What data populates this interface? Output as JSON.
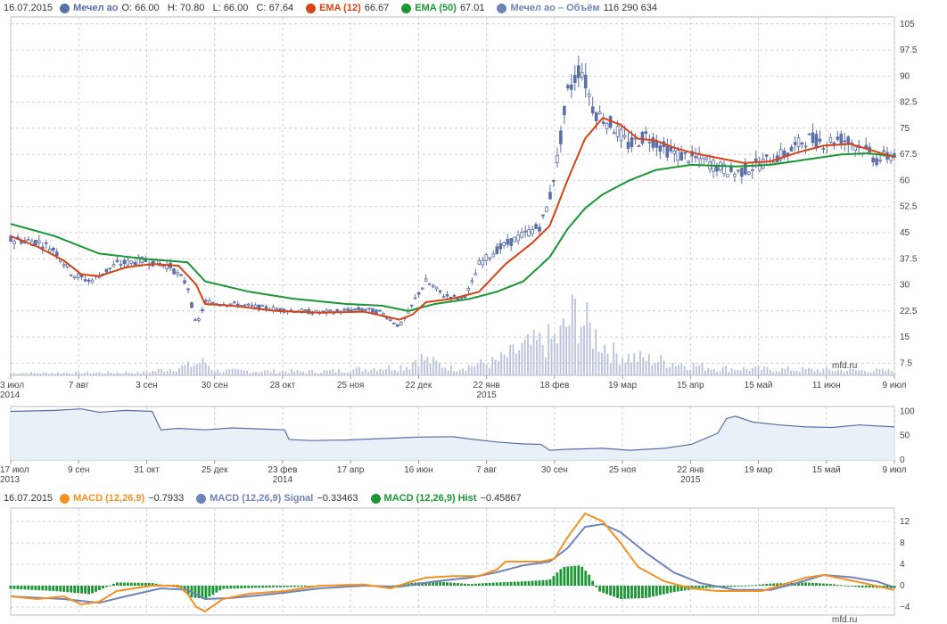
{
  "main_legend": {
    "date": "16.07.2015",
    "ticker": "Мечел ао",
    "ohlc": "O: 66.00   H: 70.80   L: 66.00   C: 67.64",
    "ema12_label": "EMA (12)",
    "ema12_value": "66.67",
    "ema50_label": "EMA (50)",
    "ema50_value": "67.01",
    "volume_label": "Мечел ао – Объём",
    "volume_value": "116 290 634"
  },
  "macd_legend": {
    "date": "16.07.2015",
    "macd_label": "MACD (12,26,9)",
    "macd_value": "−0.7933",
    "signal_label": "MACD (12,26,9) Signal",
    "signal_value": "−0.33463",
    "hist_label": "MACD (12,26,9) Hist",
    "hist_value": "−0.45867"
  },
  "watermark": "mfd.ru",
  "colors": {
    "price": "#5b6fa8",
    "ema12": "#d84315",
    "ema50": "#1a9632",
    "volume": "#b8c1dc",
    "macd": "#f39223",
    "signal": "#6f83b9",
    "hist": "#1a9632",
    "nav_fill": "#e8f0f8",
    "grid": "#cfcfcf"
  },
  "chart_data": [
    {
      "type": "line",
      "name": "price",
      "x_ticks": [
        "3 июл\n2014",
        "7 авг",
        "3 сен",
        "30 сен",
        "28 окт",
        "25 ноя",
        "22 дек",
        "22 янв\n2015",
        "18 фев",
        "19 мар",
        "15 апр",
        "15 май",
        "11 июн",
        "9 июл"
      ],
      "y_ticks": [
        "7.5",
        "15",
        "22.5",
        "30",
        "37.5",
        "45",
        "52.5",
        "60",
        "67.5",
        "75",
        "82.5",
        "90",
        "97.5",
        "105"
      ],
      "ylim": [
        4,
        107
      ],
      "series": [
        {
          "name": "Мечел ао",
          "points": [
            [
              0,
              43
            ],
            [
              0.03,
              42.5
            ],
            [
              0.05,
              40
            ],
            [
              0.07,
              33
            ],
            [
              0.09,
              31
            ],
            [
              0.12,
              36
            ],
            [
              0.15,
              37
            ],
            [
              0.18,
              35.5
            ],
            [
              0.2,
              30
            ],
            [
              0.21,
              18
            ],
            [
              0.22,
              25
            ],
            [
              0.25,
              24.5
            ],
            [
              0.3,
              23
            ],
            [
              0.35,
              22
            ],
            [
              0.4,
              23
            ],
            [
              0.42,
              22
            ],
            [
              0.43,
              20
            ],
            [
              0.44,
              18
            ],
            [
              0.45,
              22
            ],
            [
              0.46,
              27
            ],
            [
              0.47,
              31
            ],
            [
              0.49,
              27
            ],
            [
              0.51,
              26
            ],
            [
              0.52,
              29
            ],
            [
              0.53,
              36
            ],
            [
              0.55,
              40
            ],
            [
              0.57,
              43
            ],
            [
              0.6,
              47
            ],
            [
              0.61,
              55
            ],
            [
              0.62,
              68
            ],
            [
              0.63,
              85
            ],
            [
              0.645,
              93
            ],
            [
              0.66,
              80
            ],
            [
              0.68,
              76
            ],
            [
              0.7,
              70
            ],
            [
              0.72,
              73
            ],
            [
              0.74,
              69
            ],
            [
              0.76,
              67
            ],
            [
              0.78,
              66
            ],
            [
              0.8,
              64
            ],
            [
              0.82,
              62
            ],
            [
              0.84,
              64
            ],
            [
              0.86,
              66
            ],
            [
              0.88,
              68
            ],
            [
              0.9,
              72
            ],
            [
              0.92,
              71
            ],
            [
              0.94,
              72
            ],
            [
              0.96,
              70
            ],
            [
              0.98,
              66
            ],
            [
              1,
              67.6
            ]
          ]
        },
        {
          "name": "EMA (12)",
          "points": [
            [
              0,
              44
            ],
            [
              0.03,
              41
            ],
            [
              0.06,
              37
            ],
            [
              0.08,
              33
            ],
            [
              0.1,
              32.5
            ],
            [
              0.13,
              35
            ],
            [
              0.16,
              36
            ],
            [
              0.19,
              35.5
            ],
            [
              0.21,
              30
            ],
            [
              0.22,
              24.5
            ],
            [
              0.25,
              24
            ],
            [
              0.3,
              22.5
            ],
            [
              0.35,
              22
            ],
            [
              0.4,
              22.3
            ],
            [
              0.44,
              20
            ],
            [
              0.455,
              21.5
            ],
            [
              0.47,
              25
            ],
            [
              0.5,
              26
            ],
            [
              0.53,
              28
            ],
            [
              0.56,
              36
            ],
            [
              0.59,
              42
            ],
            [
              0.61,
              47
            ],
            [
              0.63,
              60
            ],
            [
              0.65,
              72
            ],
            [
              0.67,
              78
            ],
            [
              0.69,
              76
            ],
            [
              0.71,
              72
            ],
            [
              0.73,
              71.5
            ],
            [
              0.75,
              69.5
            ],
            [
              0.77,
              68
            ],
            [
              0.8,
              66.5
            ],
            [
              0.83,
              65
            ],
            [
              0.86,
              65.5
            ],
            [
              0.89,
              68
            ],
            [
              0.92,
              70
            ],
            [
              0.95,
              70.5
            ],
            [
              0.97,
              69
            ],
            [
              1,
              66.7
            ]
          ]
        },
        {
          "name": "EMA (50)",
          "points": [
            [
              0,
              47.5
            ],
            [
              0.05,
              44
            ],
            [
              0.1,
              39
            ],
            [
              0.15,
              37.5
            ],
            [
              0.2,
              36.5
            ],
            [
              0.22,
              31
            ],
            [
              0.27,
              28
            ],
            [
              0.32,
              26
            ],
            [
              0.38,
              24.5
            ],
            [
              0.42,
              24
            ],
            [
              0.45,
              22.5
            ],
            [
              0.48,
              24.5
            ],
            [
              0.52,
              26
            ],
            [
              0.55,
              28
            ],
            [
              0.58,
              31
            ],
            [
              0.61,
              38
            ],
            [
              0.63,
              46
            ],
            [
              0.65,
              52
            ],
            [
              0.67,
              56
            ],
            [
              0.7,
              60
            ],
            [
              0.73,
              63
            ],
            [
              0.77,
              64.5
            ],
            [
              0.82,
              64
            ],
            [
              0.86,
              64.5
            ],
            [
              0.9,
              66
            ],
            [
              0.94,
              67.5
            ],
            [
              0.97,
              67.8
            ],
            [
              1,
              67
            ]
          ]
        }
      ]
    },
    {
      "type": "area",
      "name": "navigator",
      "x_ticks": [
        "17 июл\n2013",
        "9 сен",
        "31 окт",
        "25 дек",
        "23 фев\n2014",
        "17 апр",
        "16 июн",
        "7 авг",
        "30 сен",
        "25 ноя",
        "22 янв\n2015",
        "19 мар",
        "15 май",
        "9 июл"
      ],
      "y_ticks": [
        "0",
        "50",
        "100"
      ],
      "ylim": [
        0,
        110
      ],
      "values": [
        [
          0,
          100
        ],
        [
          0.05,
          102
        ],
        [
          0.08,
          105
        ],
        [
          0.1,
          98
        ],
        [
          0.13,
          102
        ],
        [
          0.16,
          100
        ],
        [
          0.17,
          62
        ],
        [
          0.19,
          65
        ],
        [
          0.22,
          62
        ],
        [
          0.25,
          66
        ],
        [
          0.28,
          64
        ],
        [
          0.31,
          62
        ],
        [
          0.315,
          42
        ],
        [
          0.34,
          40
        ],
        [
          0.38,
          41
        ],
        [
          0.42,
          44
        ],
        [
          0.46,
          47
        ],
        [
          0.5,
          48
        ],
        [
          0.52,
          43
        ],
        [
          0.55,
          37
        ],
        [
          0.58,
          33
        ],
        [
          0.6,
          32
        ],
        [
          0.61,
          20
        ],
        [
          0.63,
          22
        ],
        [
          0.67,
          24
        ],
        [
          0.7,
          20
        ],
        [
          0.74,
          24
        ],
        [
          0.77,
          32
        ],
        [
          0.8,
          55
        ],
        [
          0.81,
          85
        ],
        [
          0.82,
          90
        ],
        [
          0.84,
          78
        ],
        [
          0.87,
          72
        ],
        [
          0.9,
          68
        ],
        [
          0.93,
          67
        ],
        [
          0.96,
          72
        ],
        [
          1,
          68
        ]
      ]
    },
    {
      "type": "line",
      "name": "macd",
      "x_ticks": [],
      "y_ticks": [
        "−4",
        "0",
        "4",
        "8",
        "12"
      ],
      "ylim": [
        -5.5,
        14.5
      ],
      "series": [
        {
          "name": "MACD (12,26,9)",
          "points": [
            [
              0,
              -2
            ],
            [
              0.03,
              -2.5
            ],
            [
              0.06,
              -2
            ],
            [
              0.08,
              -3.5
            ],
            [
              0.1,
              -3
            ],
            [
              0.12,
              -1
            ],
            [
              0.16,
              0
            ],
            [
              0.19,
              0
            ],
            [
              0.2,
              -1.5
            ],
            [
              0.21,
              -4
            ],
            [
              0.22,
              -4.8
            ],
            [
              0.24,
              -2.5
            ],
            [
              0.27,
              -1.5
            ],
            [
              0.31,
              -1
            ],
            [
              0.35,
              0
            ],
            [
              0.4,
              0.2
            ],
            [
              0.43,
              -0.5
            ],
            [
              0.45,
              0.6
            ],
            [
              0.47,
              1.5
            ],
            [
              0.5,
              1.8
            ],
            [
              0.53,
              1.8
            ],
            [
              0.55,
              3
            ],
            [
              0.56,
              4.5
            ],
            [
              0.6,
              4.5
            ],
            [
              0.615,
              5
            ],
            [
              0.63,
              9
            ],
            [
              0.65,
              13.5
            ],
            [
              0.67,
              12
            ],
            [
              0.69,
              8
            ],
            [
              0.71,
              3.5
            ],
            [
              0.74,
              0.8
            ],
            [
              0.77,
              -0.5
            ],
            [
              0.8,
              -1
            ],
            [
              0.85,
              -1
            ],
            [
              0.88,
              0.5
            ],
            [
              0.9,
              1.5
            ],
            [
              0.92,
              2
            ],
            [
              0.95,
              1
            ],
            [
              0.97,
              0.3
            ],
            [
              1,
              -0.8
            ]
          ]
        },
        {
          "name": "MACD (12,26,9) Signal",
          "points": [
            [
              0,
              -2
            ],
            [
              0.06,
              -2.5
            ],
            [
              0.1,
              -3.2
            ],
            [
              0.13,
              -2
            ],
            [
              0.17,
              -0.5
            ],
            [
              0.2,
              -0.8
            ],
            [
              0.22,
              -2.5
            ],
            [
              0.25,
              -2.3
            ],
            [
              0.3,
              -1.5
            ],
            [
              0.35,
              -0.5
            ],
            [
              0.4,
              0
            ],
            [
              0.44,
              -0.2
            ],
            [
              0.48,
              0.8
            ],
            [
              0.52,
              1.5
            ],
            [
              0.55,
              2.5
            ],
            [
              0.58,
              3.8
            ],
            [
              0.61,
              4.5
            ],
            [
              0.63,
              7
            ],
            [
              0.65,
              11
            ],
            [
              0.67,
              11.5
            ],
            [
              0.69,
              10
            ],
            [
              0.72,
              6
            ],
            [
              0.75,
              2.5
            ],
            [
              0.78,
              0.5
            ],
            [
              0.82,
              -0.8
            ],
            [
              0.86,
              -0.8
            ],
            [
              0.89,
              0.5
            ],
            [
              0.92,
              2
            ],
            [
              0.95,
              1.6
            ],
            [
              0.98,
              0.8
            ],
            [
              1,
              -0.3
            ]
          ]
        },
        {
          "name": "MACD (12,26,9) Hist",
          "points": [
            [
              0,
              -0.6
            ],
            [
              0.05,
              -1
            ],
            [
              0.09,
              -1.6
            ],
            [
              0.12,
              0.6
            ],
            [
              0.16,
              0.5
            ],
            [
              0.19,
              -0.4
            ],
            [
              0.205,
              -2.2
            ],
            [
              0.22,
              -2.5
            ],
            [
              0.24,
              -0.6
            ],
            [
              0.28,
              -0.4
            ],
            [
              0.33,
              -0.2
            ],
            [
              0.38,
              0.3
            ],
            [
              0.42,
              -0.3
            ],
            [
              0.45,
              0.5
            ],
            [
              0.48,
              0.8
            ],
            [
              0.52,
              0.3
            ],
            [
              0.55,
              0.6
            ],
            [
              0.58,
              0.8
            ],
            [
              0.61,
              1.1
            ],
            [
              0.625,
              3.5
            ],
            [
              0.645,
              3.8
            ],
            [
              0.655,
              2
            ],
            [
              0.665,
              -1
            ],
            [
              0.69,
              -2.5
            ],
            [
              0.72,
              -2.3
            ],
            [
              0.75,
              -1.2
            ],
            [
              0.78,
              -0.5
            ],
            [
              0.82,
              -0.2
            ],
            [
              0.86,
              0.4
            ],
            [
              0.9,
              0.6
            ],
            [
              0.93,
              0.3
            ],
            [
              0.96,
              -0.3
            ],
            [
              1,
              -0.5
            ]
          ]
        }
      ]
    }
  ]
}
